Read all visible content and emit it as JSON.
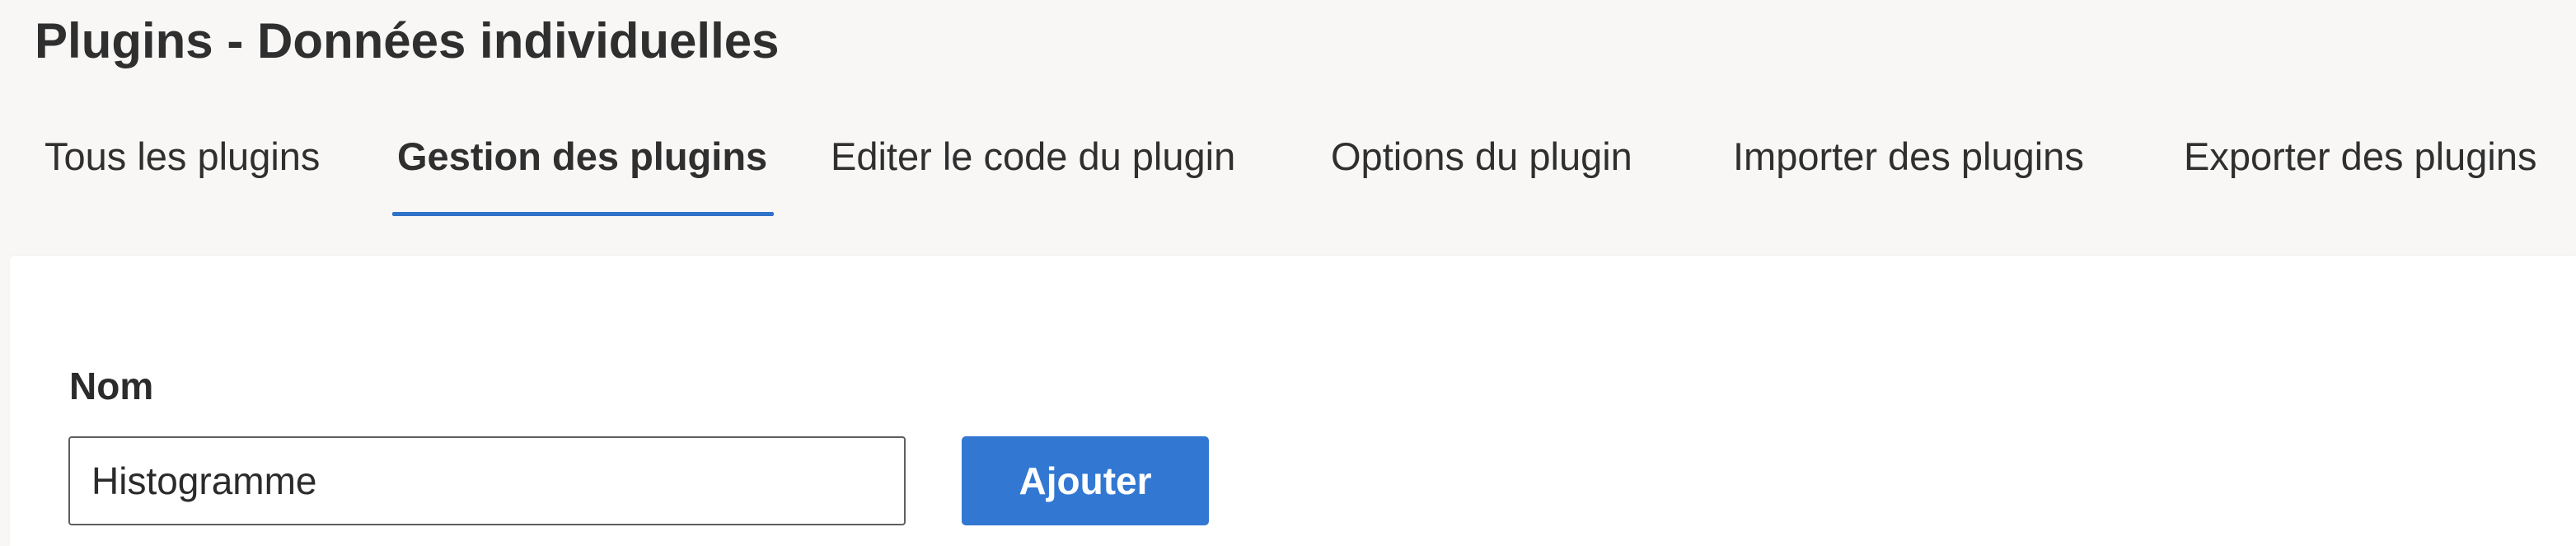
{
  "header": {
    "title": "Plugins - Données individuelles"
  },
  "tabs": [
    {
      "label": "Tous les plugins",
      "active": false
    },
    {
      "label": "Gestion des plugins",
      "active": true
    },
    {
      "label": "Editer le code du plugin",
      "active": false
    },
    {
      "label": "Options du plugin",
      "active": false
    },
    {
      "label": "Importer des plugins",
      "active": false
    },
    {
      "label": "Exporter des plugins",
      "active": false
    }
  ],
  "form": {
    "name_label": "Nom",
    "name_value": "Histogramme",
    "add_button_label": "Ajouter"
  },
  "colors": {
    "accent": "#3278d2",
    "tab_underline": "#2f73c9",
    "header_background": "#f8f7f6",
    "panel_background": "#ffffff"
  }
}
